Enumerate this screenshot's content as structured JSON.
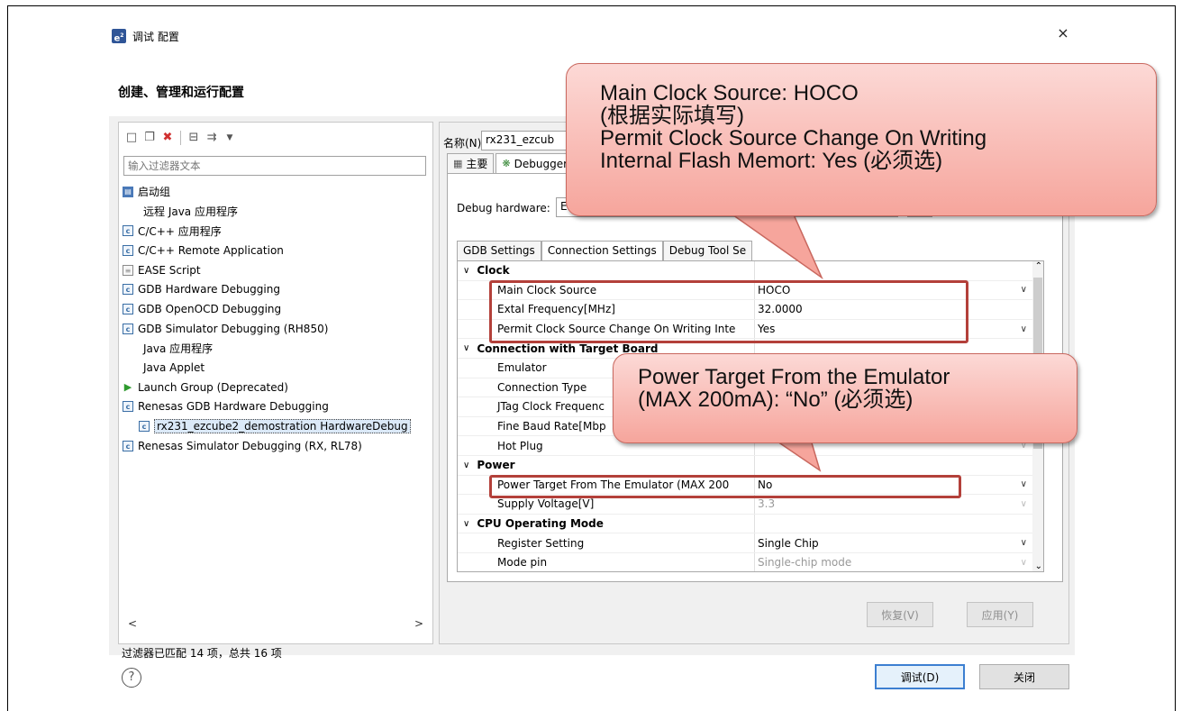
{
  "dialog": {
    "app_icon": "e²",
    "title": "调试 配置",
    "header_title": "创建、管理和运行配置",
    "close_glyph": "×"
  },
  "left_panel": {
    "filter_placeholder": "输入过滤器文本",
    "tree": [
      {
        "label": "启动组",
        "icon": "launch-group-icon",
        "indent": 0
      },
      {
        "label": "远程 Java 应用程序",
        "icon": "none",
        "indent": 1
      },
      {
        "label": "C/C++ 应用程序",
        "icon": "c-config-icon",
        "indent": 0
      },
      {
        "label": "C/C++ Remote Application",
        "icon": "c-config-icon",
        "indent": 0
      },
      {
        "label": "EASE Script",
        "icon": "script-icon",
        "indent": 0
      },
      {
        "label": "GDB Hardware Debugging",
        "icon": "c-config-icon",
        "indent": 0
      },
      {
        "label": "GDB OpenOCD Debugging",
        "icon": "c-config-icon",
        "indent": 0
      },
      {
        "label": "GDB Simulator Debugging (RH850)",
        "icon": "c-config-icon",
        "indent": 0
      },
      {
        "label": "Java 应用程序",
        "icon": "none",
        "indent": 1
      },
      {
        "label": "Java Applet",
        "icon": "none",
        "indent": 1
      },
      {
        "label": "Launch Group (Deprecated)",
        "icon": "play-icon",
        "indent": 0
      },
      {
        "label": "Renesas GDB Hardware Debugging",
        "icon": "c-config-icon",
        "indent": 0
      },
      {
        "label": "rx231_ezcube2_demostration HardwareDebug",
        "icon": "c-config-icon",
        "indent": 2,
        "selected": true
      },
      {
        "label": "Renesas Simulator Debugging (RX, RL78)",
        "icon": "c-config-icon",
        "indent": 0
      }
    ],
    "scroll_left": "<",
    "scroll_right": ">",
    "filter_status": "过滤器已匹配 14 项，总共 16 项"
  },
  "right_panel": {
    "name_label": "名称(N):",
    "name_value": "rx231_ezcub",
    "tabs": [
      {
        "label": "主要",
        "icon": "main-tab-icon"
      },
      {
        "label": "Debugger",
        "icon": "debugger-tab-icon"
      }
    ],
    "debug_hardware_label": "Debug hardware:",
    "debug_hardware_value": "E2",
    "sub_tabs": [
      "GDB Settings",
      "Connection Settings",
      "Debug Tool Se"
    ],
    "settings": [
      {
        "type": "group",
        "name": "Clock"
      },
      {
        "type": "prop",
        "name": "Main Clock Source",
        "value": "HOCO",
        "dropdown": true
      },
      {
        "type": "prop",
        "name": "Extal Frequency[MHz]",
        "value": "32.0000"
      },
      {
        "type": "prop",
        "name": "Permit Clock Source Change On Writing Inte",
        "value": "Yes",
        "dropdown": true
      },
      {
        "type": "group",
        "name": "Connection with Target Board"
      },
      {
        "type": "prop",
        "name": "Emulator",
        "value": ""
      },
      {
        "type": "prop",
        "name": "Connection Type",
        "value": ""
      },
      {
        "type": "prop",
        "name": "JTag Clock Frequenc",
        "value": ""
      },
      {
        "type": "prop",
        "name": "Fine Baud Rate[Mbp",
        "value": ""
      },
      {
        "type": "prop",
        "name": "Hot Plug",
        "value": "",
        "dropdown": true,
        "disabled": true
      },
      {
        "type": "group",
        "name": "Power"
      },
      {
        "type": "prop",
        "name": "Power Target From The Emulator (MAX 200",
        "value": "No",
        "dropdown": true
      },
      {
        "type": "prop",
        "name": "Supply Voltage[V]",
        "value": "3.3",
        "dropdown": true,
        "disabled": true
      },
      {
        "type": "group",
        "name": "CPU Operating Mode"
      },
      {
        "type": "prop",
        "name": "Register Setting",
        "value": "Single Chip",
        "dropdown": true
      },
      {
        "type": "prop",
        "name": "Mode pin",
        "value": "Single-chip mode",
        "dropdown": true,
        "disabled": true
      }
    ],
    "revert_label": "恢复(V)",
    "apply_label": "应用(Y)"
  },
  "bottom": {
    "help_glyph": "?",
    "debug_label": "调试(D)",
    "close_label": "关闭"
  },
  "callouts": [
    {
      "lines": [
        "Main Clock Source: HOCO",
        "(根据实际填写)",
        "Permit Clock Source Change On Writing",
        "Internal Flash Memort: Yes (必须选)"
      ]
    },
    {
      "lines": [
        "Power Target From the Emulator",
        "(MAX 200mA): “No” (必须选)"
      ]
    }
  ],
  "colors": {
    "highlight_box": "#b3403a",
    "callout_fill": "#f6a59c",
    "primary_button_border": "#3c7fd1"
  }
}
